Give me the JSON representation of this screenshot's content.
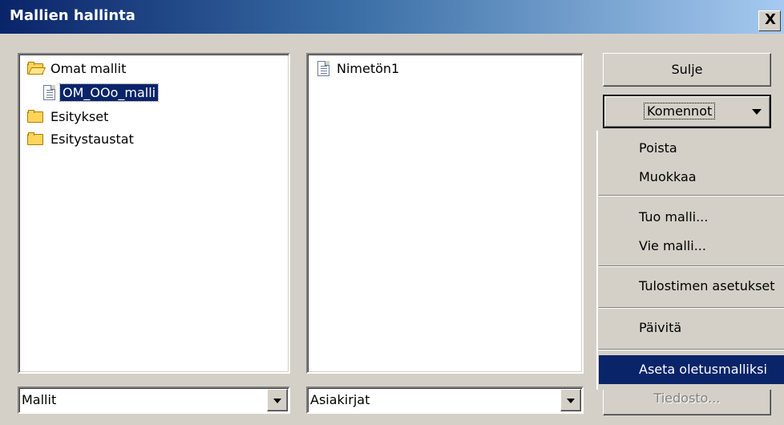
{
  "window": {
    "title": "Mallien hallinta",
    "close_glyph": "X"
  },
  "categories_tree": {
    "items": [
      {
        "label": "Omat mallit",
        "icon": "folder-open-icon"
      },
      {
        "label": "OM_OOo_malli",
        "icon": "document-icon",
        "selected": true
      },
      {
        "label": "Esitykset",
        "icon": "folder-icon"
      },
      {
        "label": "Esitystaustat",
        "icon": "folder-icon"
      }
    ]
  },
  "documents_list": {
    "items": [
      {
        "label": "Nimetön1",
        "icon": "document-icon"
      }
    ]
  },
  "buttons": {
    "close": "Sulje",
    "commands": "Komennot",
    "file": "Tiedosto..."
  },
  "commands_menu": {
    "items": [
      {
        "label": "Poista"
      },
      {
        "label": "Muokkaa"
      },
      {
        "label": "Tuo malli..."
      },
      {
        "label": "Vie malli..."
      },
      {
        "label": "Tulostimen asetukset"
      },
      {
        "label": "Päivitä"
      },
      {
        "label": "Aseta oletusmalliksi",
        "highlighted": true
      }
    ]
  },
  "combos": {
    "left_value": "Mallit",
    "mid_value": "Asiakirjat"
  },
  "colors": {
    "selection": "#0a246a",
    "title_bar_start": "#0a246a",
    "title_bar_end": "#a6caf0",
    "face": "#d4d0c8"
  }
}
